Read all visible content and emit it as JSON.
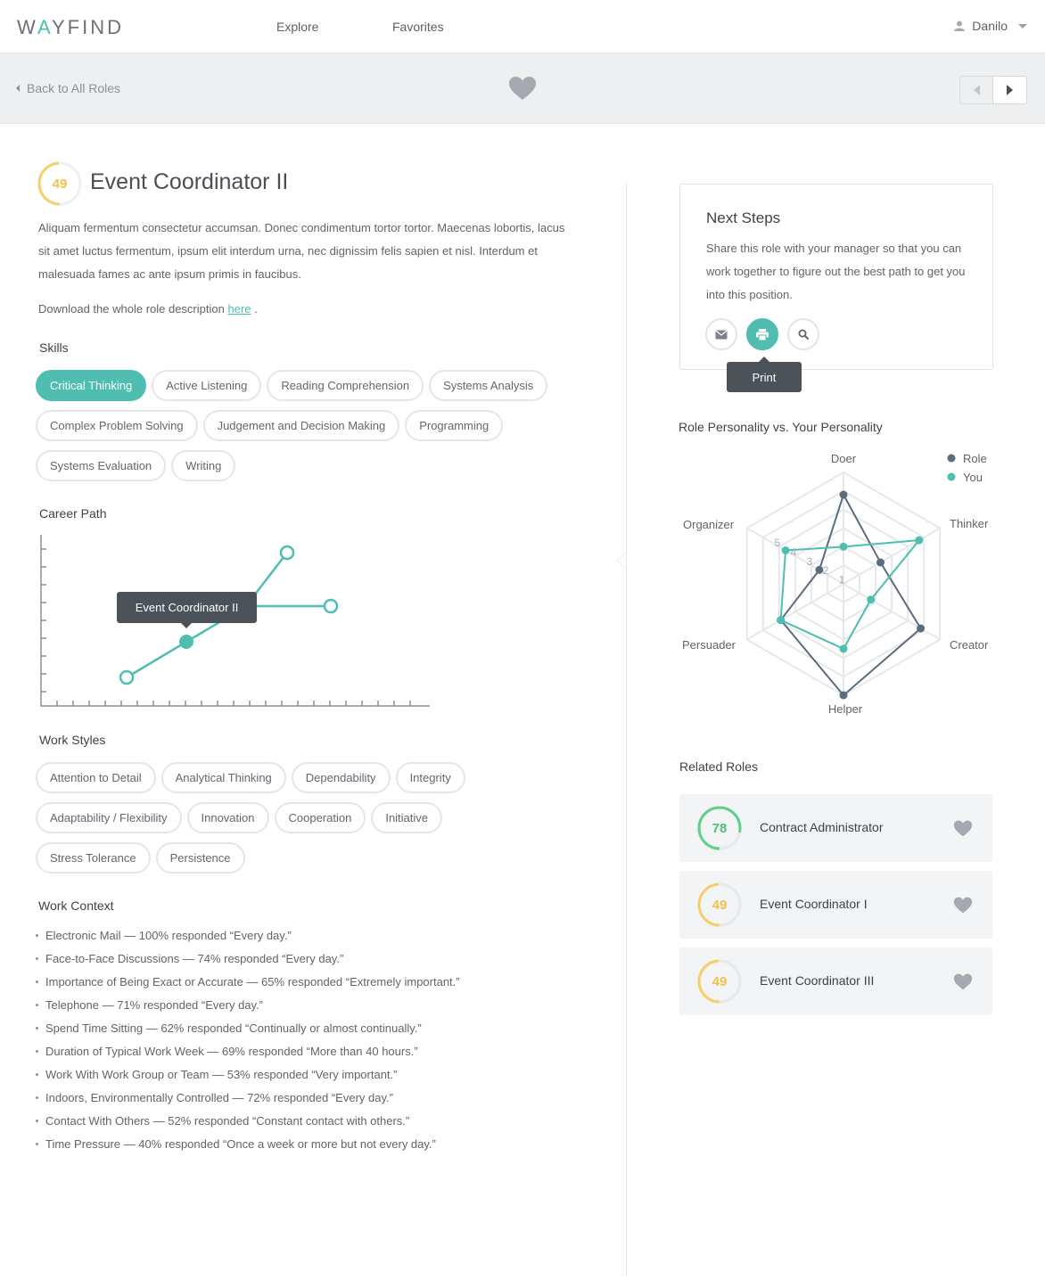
{
  "header": {
    "logo": "WAYFIND",
    "nav": [
      "Explore",
      "Favorites"
    ],
    "user_name": "Danilo"
  },
  "subbar": {
    "back_label": "Back to All Roles"
  },
  "role": {
    "score": "49",
    "title": "Event Coordinator II",
    "description": "Aliquam fermentum consectetur accumsan. Donec condimentum tortor tortor. Maecenas lobortis, lacus sit amet luctus fermentum, ipsum elit interdum urna, nec dignissim felis sapien et nisl. Interdum et malesuada fames ac ante ipsum primis in faucibus.",
    "download_prefix": "Download the whole role description",
    "download_link": "here",
    "download_suffix": "."
  },
  "skills": {
    "heading": "Skills",
    "items": [
      "Critical Thinking",
      "Active Listening",
      "Reading Comprehension",
      "Systems Analysis",
      "Complex Problem Solving",
      "Judgement and Decision Making",
      "Programming",
      "Systems Evaluation",
      "Writing"
    ],
    "active_index": 0
  },
  "career": {
    "heading": "Career Path",
    "tooltip": "Event Coordinator II"
  },
  "work_styles": {
    "heading": "Work Styles",
    "items": [
      "Attention to Detail",
      "Analytical Thinking",
      "Dependability",
      "Integrity",
      "Adaptability / Flexibility",
      "Innovation",
      "Cooperation",
      "Initiative",
      "Stress Tolerance",
      "Persistence"
    ]
  },
  "work_context": {
    "heading": "Work Context",
    "items": [
      "Electronic Mail — 100% responded “Every day.”",
      "Face-to-Face Discussions — 74% responded “Every day.”",
      "Importance of Being Exact or Accurate — 65% responded “Extremely important.”",
      "Telephone — 71% responded “Every day.”",
      "Spend Time Sitting — 62% responded “Continually or almost continually.”",
      "Duration of Typical Work Week — 69% responded “More than 40 hours.”",
      "Work With Work Group or Team — 53% responded “Very important.”",
      "Indoors, Environmentally Controlled — 72% responded “Every day.”",
      "Contact With Others — 52% responded “Constant contact with others.”",
      "Time Pressure — 40% responded “Once a week or more but not every day.”"
    ]
  },
  "next_steps": {
    "title": "Next Steps",
    "body": "Share this role with your manager so that you can work together to figure out the best path to get you into this position.",
    "tooltip": "Print"
  },
  "radar": {
    "title": "Role Personality vs. Your Personality",
    "axes": [
      "Doer",
      "Thinker",
      "Creator",
      "Helper",
      "Persuader",
      "Organizer"
    ],
    "ticks": [
      "1",
      "2",
      "3",
      "4",
      "5"
    ],
    "legend": [
      "Role",
      "You"
    ]
  },
  "related": {
    "title": "Related Roles",
    "items": [
      {
        "score": "78",
        "name": "Contract Administrator"
      },
      {
        "score": "49",
        "name": "Event Coordinator I"
      },
      {
        "score": "49",
        "name": "Event Coordinator III"
      }
    ]
  },
  "chart_data": {
    "type": "scatter",
    "title": "Role Personality vs. Your Personality",
    "axes": [
      "Doer",
      "Thinker",
      "Creator",
      "Helper",
      "Persuader",
      "Organizer"
    ],
    "rmax": 6,
    "series": [
      {
        "name": "Role",
        "values": [
          4.8,
          2.3,
          4.8,
          6.0,
          3.9,
          1.5
        ]
      },
      {
        "name": "You",
        "values": [
          2.0,
          4.7,
          1.7,
          3.5,
          3.9,
          3.6
        ]
      }
    ]
  },
  "colors": {
    "accent": "#4fbeb0",
    "role_series": "#5b6b80",
    "score_yellow": "#f5cf6a",
    "score_green": "#5fcf8a",
    "tooltip_bg": "#4b5258"
  }
}
